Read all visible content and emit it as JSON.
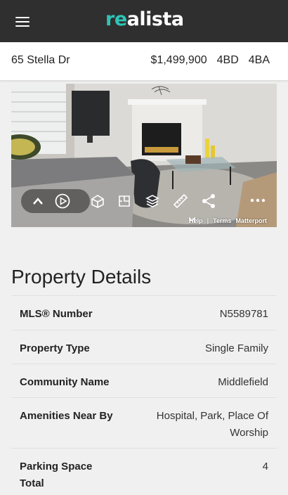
{
  "header": {
    "logo_accent": "re",
    "logo_rest": "alista",
    "menu_icon": "hamburger-menu-icon"
  },
  "summary": {
    "address": "65 Stella Dr",
    "price": "$1,499,900",
    "beds": "4BD",
    "baths": "4BA"
  },
  "virtual_tour": {
    "controls": [
      "chevron-up-icon",
      "play-icon",
      "dollhouse-icon",
      "floorplan-icon",
      "floors-icon",
      "measure-icon",
      "share-icon",
      "more-icon"
    ],
    "help": "Help",
    "separator": "|",
    "terms": "Terms",
    "brand": "Matterport"
  },
  "details": {
    "title": "Property Details",
    "rows": [
      {
        "label": "MLS® Number",
        "value": "N5589781"
      },
      {
        "label": "Property Type",
        "value": "Single Family"
      },
      {
        "label": "Community Name",
        "value": "Middlefield"
      },
      {
        "label": "Amenities Near By",
        "value": "Hospital, Park, Place Of Worship"
      },
      {
        "label": "Parking Space Total",
        "value": "4"
      }
    ]
  }
}
